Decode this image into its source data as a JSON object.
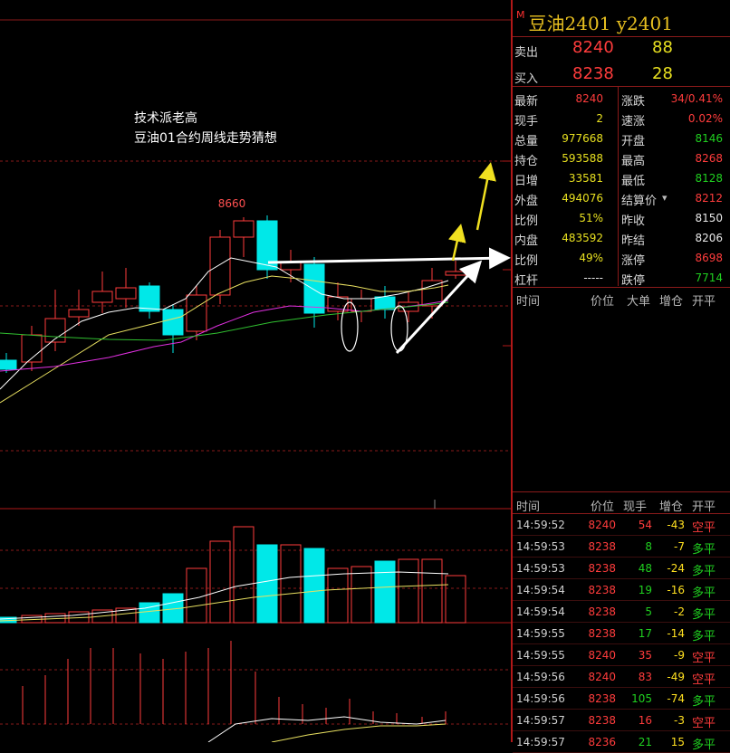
{
  "chart": {
    "annotation_line1": "技术派老高",
    "annotation_line2": "豆油01合约周线走势猜想",
    "high_label": "8660",
    "colors": {
      "up": "#ff3c3c",
      "down": "#00e8e8",
      "ma_white": "#ffffff",
      "ma_yellow": "#e8e060",
      "ma_magenta": "#e030e0",
      "ma_green": "#30c030",
      "arrow_white": "#ffffff",
      "arrow_yellow": "#f0e020"
    }
  },
  "quote": {
    "marker": "M",
    "title": "豆油2401  y2401",
    "sell_label": "卖出",
    "sell_price": "8240",
    "sell_vol": "88",
    "buy_label": "买入",
    "buy_price": "8238",
    "buy_vol": "28",
    "rows": [
      {
        "l1": "最新",
        "v1": "8240",
        "c1": "red",
        "l2": "涨跌",
        "v2": "34/0.41%",
        "c2": "red"
      },
      {
        "l1": "现手",
        "v1": "2",
        "c1": "yel",
        "l2": "速涨",
        "v2": "0.02%",
        "c2": "red"
      },
      {
        "l1": "总量",
        "v1": "977668",
        "c1": "yel",
        "l2": "开盘",
        "v2": "8146",
        "c2": "grn"
      },
      {
        "l1": "持仓",
        "v1": "593588",
        "c1": "yel",
        "l2": "最高",
        "v2": "8268",
        "c2": "red"
      },
      {
        "l1": "日增",
        "v1": "33581",
        "c1": "yel",
        "l2": "最低",
        "v2": "8128",
        "c2": "grn"
      },
      {
        "l1": "外盘",
        "v1": "494076",
        "c1": "yel",
        "l2": "结算价",
        "v2": "8212",
        "c2": "red"
      },
      {
        "l1": "比例",
        "v1": "51%",
        "c1": "yel",
        "l2": "昨收",
        "v2": "8150",
        "c2": "wht"
      },
      {
        "l1": "内盘",
        "v1": "483592",
        "c1": "yel",
        "l2": "昨结",
        "v2": "8206",
        "c2": "wht"
      },
      {
        "l1": "比例",
        "v1": "49%",
        "c1": "yel",
        "l2": "涨停",
        "v2": "8698",
        "c2": "red"
      },
      {
        "l1": "杠杆",
        "v1": "-----",
        "c1": "wht",
        "l2": "跌停",
        "v2": "7714",
        "c2": "grn"
      }
    ]
  },
  "ticks_header": {
    "time": "时间",
    "price": "价位",
    "big": "大单",
    "add": "增仓",
    "open": "开平"
  },
  "trades_header": {
    "time": "时间",
    "price": "价位",
    "hand": "现手",
    "add": "增仓",
    "open": "开平"
  },
  "trades": [
    {
      "time": "14:59:52",
      "price": "8240",
      "pc": "red",
      "hand": "54",
      "hc": "red",
      "add": "-43",
      "type": "空平"
    },
    {
      "time": "14:59:53",
      "price": "8238",
      "pc": "red",
      "hand": "8",
      "hc": "grn",
      "add": "-7",
      "type": "多平"
    },
    {
      "time": "14:59:53",
      "price": "8238",
      "pc": "red",
      "hand": "48",
      "hc": "grn",
      "add": "-24",
      "type": "多平"
    },
    {
      "time": "14:59:54",
      "price": "8238",
      "pc": "red",
      "hand": "19",
      "hc": "grn",
      "add": "-16",
      "type": "多平"
    },
    {
      "time": "14:59:54",
      "price": "8238",
      "pc": "red",
      "hand": "5",
      "hc": "grn",
      "add": "-2",
      "type": "多平"
    },
    {
      "time": "14:59:55",
      "price": "8238",
      "pc": "red",
      "hand": "17",
      "hc": "grn",
      "add": "-14",
      "type": "多平"
    },
    {
      "time": "14:59:55",
      "price": "8240",
      "pc": "red",
      "hand": "35",
      "hc": "red",
      "add": "-9",
      "type": "空平"
    },
    {
      "time": "14:59:56",
      "price": "8240",
      "pc": "red",
      "hand": "83",
      "hc": "red",
      "add": "-49",
      "type": "空平"
    },
    {
      "time": "14:59:56",
      "price": "8238",
      "pc": "red",
      "hand": "105",
      "hc": "grn",
      "add": "-74",
      "type": "多平"
    },
    {
      "time": "14:59:57",
      "price": "8238",
      "pc": "red",
      "hand": "16",
      "hc": "red",
      "add": "-3",
      "type": "空平"
    },
    {
      "time": "14:59:57",
      "price": "8236",
      "pc": "red",
      "hand": "21",
      "hc": "grn",
      "add": "15",
      "type": "多平"
    }
  ]
}
